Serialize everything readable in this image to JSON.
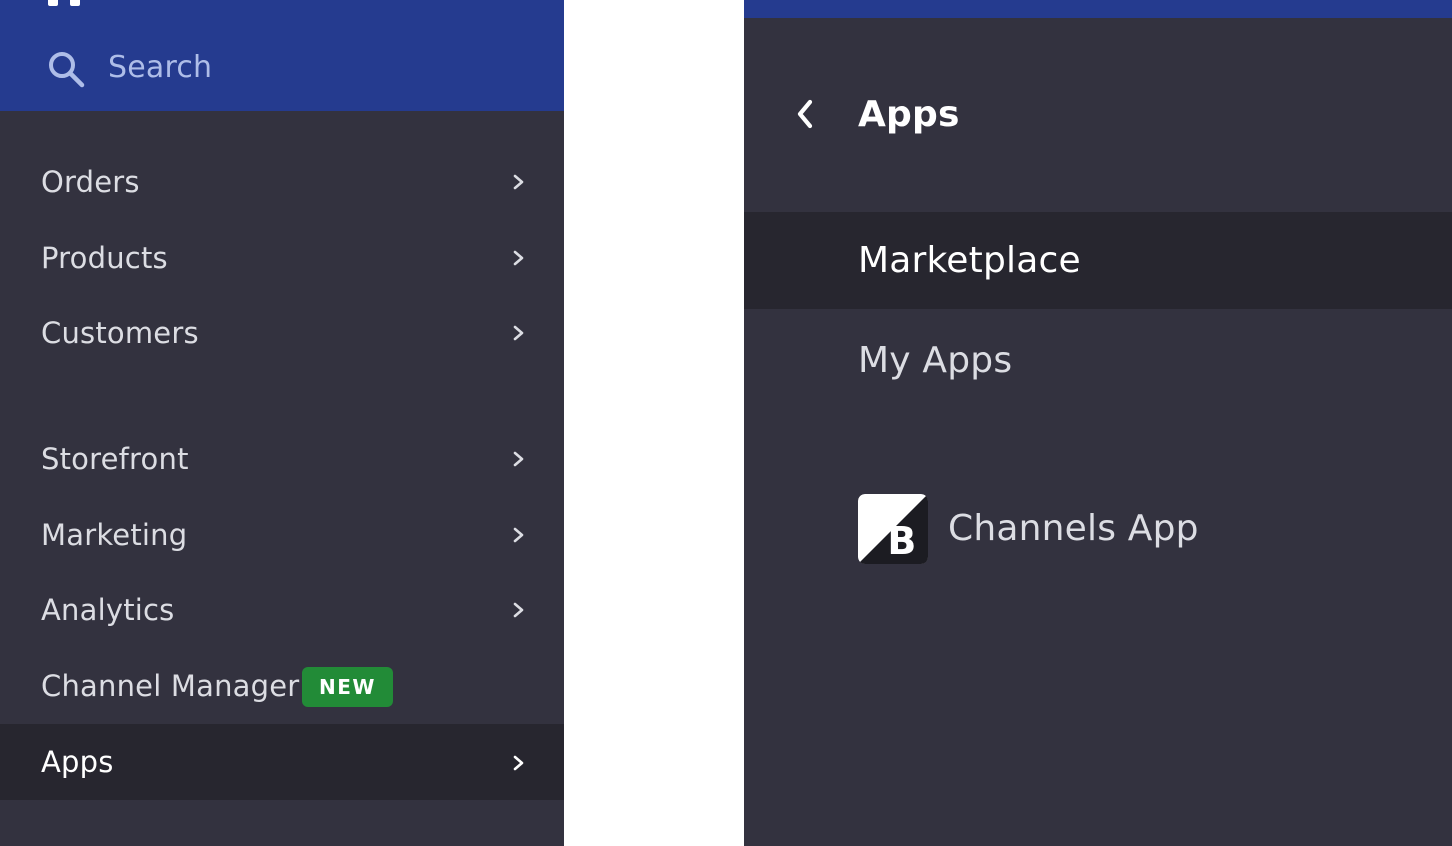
{
  "left_panel": {
    "search": {
      "label": "Search",
      "icon": "search-icon"
    },
    "nav_items": [
      {
        "label": "Orders",
        "has_chevron": true
      },
      {
        "label": "Products",
        "has_chevron": true
      },
      {
        "label": "Customers",
        "has_chevron": true
      },
      {
        "label": "Storefront",
        "has_chevron": true
      },
      {
        "label": "Marketing",
        "has_chevron": true
      },
      {
        "label": "Analytics",
        "has_chevron": true
      },
      {
        "label": "Channel Manager",
        "badge": "NEW"
      },
      {
        "label": "Apps",
        "has_chevron": true,
        "active": true
      }
    ]
  },
  "right_panel": {
    "title": "Apps",
    "back_icon": "chevron-left-icon",
    "items": [
      {
        "label": "Marketplace",
        "active": true
      },
      {
        "label": "My Apps"
      }
    ],
    "apps": [
      {
        "name": "Channels App",
        "icon": "bigcommerce-logo-icon"
      }
    ]
  },
  "colors": {
    "panel_bg": "#33323f",
    "active_bg": "#27262f",
    "header_blue": "#253b8f",
    "badge_green": "#228b37"
  }
}
